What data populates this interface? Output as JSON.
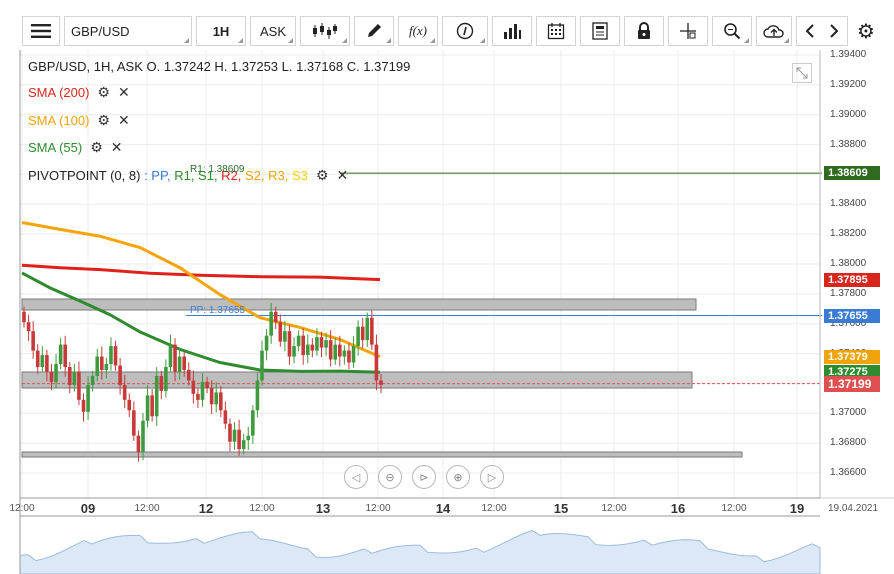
{
  "toolbar": {
    "symbol": "GBP/USD",
    "timeframe": "1H",
    "price_type": "ASK",
    "icons": [
      "menu-icon",
      "candles-icon",
      "pencil-icon",
      "fx-icon",
      "info-icon",
      "bars-icon",
      "calendar-icon",
      "news-icon",
      "lock-icon",
      "crosshair-icon",
      "zoom-icon",
      "cloud-icon",
      "chevron-left-icon",
      "chevron-right-icon",
      "gear-icon"
    ],
    "fx_label": "f(x)"
  },
  "legend": {
    "ohlc": "GBP/USD, 1H, ASK   O. 1.37242 H. 1.37253 L. 1.37168 C. 1.37199",
    "sma200": "SMA (200)",
    "sma100": "SMA (100)",
    "sma55": "SMA (55)",
    "pivot_label": "PIVOTPOINT (0, 8)",
    "pivot_items": [
      {
        "text": ": PP,",
        "color": "#3a7bd5"
      },
      {
        "text": " R1,",
        "color": "#2e8b2e"
      },
      {
        "text": " S1,",
        "color": "#2e8b2e"
      },
      {
        "text": " R2,",
        "color": "#d9261c"
      },
      {
        "text": " S2,",
        "color": "#f0a30a"
      },
      {
        "text": " R3,",
        "color": "#f0a30a"
      },
      {
        "text": " S3",
        "color": "#f5d20a"
      }
    ],
    "r1_overlay": "R1: 1.38609",
    "pp_label": "PP: 1.37655"
  },
  "y_axis": {
    "ticks": [
      "1.39400",
      "1.39200",
      "1.39000",
      "1.38800",
      "1.38600",
      "1.38400",
      "1.38200",
      "1.38000",
      "1.37800",
      "1.37600",
      "1.37400",
      "1.37200",
      "1.37000",
      "1.36800",
      "1.36600"
    ]
  },
  "price_badges": [
    {
      "value": "1.38609",
      "color": "#2f6b1f",
      "price": 1.38609
    },
    {
      "value": "1.37895",
      "color": "#d9261c",
      "price": 1.37895
    },
    {
      "value": "1.37655",
      "color": "#3a7bd5",
      "price": 1.37655
    },
    {
      "value": "1.37379",
      "color": "#f0a30a",
      "price": 1.37379
    },
    {
      "value": "1.37275",
      "color": "#2e8b2e",
      "price": 1.37275
    },
    {
      "value": "1.37199",
      "color": "#e05050",
      "price": 1.37199
    }
  ],
  "x_axis": [
    {
      "label": "12:00",
      "big": false
    },
    {
      "label": "09",
      "big": true
    },
    {
      "label": "12:00",
      "big": false
    },
    {
      "label": "12",
      "big": true
    },
    {
      "label": "12:00",
      "big": false
    },
    {
      "label": "13",
      "big": true
    },
    {
      "label": "12:00",
      "big": false
    },
    {
      "label": "14",
      "big": true
    },
    {
      "label": "12:00",
      "big": false
    },
    {
      "label": "15",
      "big": true
    },
    {
      "label": "12:00",
      "big": false
    },
    {
      "label": "16",
      "big": true
    },
    {
      "label": "12:00",
      "big": false
    },
    {
      "label": "19",
      "big": true
    },
    {
      "label": "19.04.2021",
      "big": false
    }
  ],
  "nav_controls": [
    "prev-icon",
    "zoom-out-icon",
    "reset-icon",
    "zoom-in-icon",
    "next-icon"
  ],
  "colors": {
    "sma200": "#e0201a",
    "sma100": "#f5a50a",
    "sma55": "#2e8b2e",
    "up": "#3f9a3f",
    "down": "#c83a3a"
  }
}
